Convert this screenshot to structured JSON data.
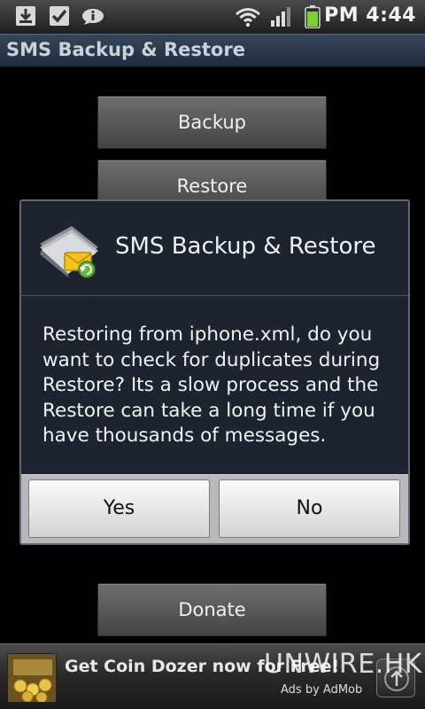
{
  "status_bar": {
    "time": "PM 4:44",
    "icons": [
      "download-icon",
      "check-task-icon",
      "info-bubble-icon",
      "wifi-icon",
      "signal-icon",
      "battery-icon"
    ]
  },
  "app": {
    "title": "SMS Backup & Restore"
  },
  "main": {
    "backup_label": "Backup",
    "restore_label": "Restore",
    "donate_label": "Donate"
  },
  "dialog": {
    "title": "SMS Backup & Restore",
    "message": "Restoring from iphone.xml, do you want to check for duplicates during Restore? Its a slow process and the Restore can take a long time if you have thousands of messages.",
    "yes_label": "Yes",
    "no_label": "No"
  },
  "ad": {
    "text": "Get Coin Dozer now for Free!",
    "provider": "Ads by AdMob"
  },
  "watermark": "UNWIRE.HK",
  "colors": {
    "title_bar": "#2a3a4c",
    "dialog_bg": "#1d2430",
    "battery": "#7cd12c"
  }
}
